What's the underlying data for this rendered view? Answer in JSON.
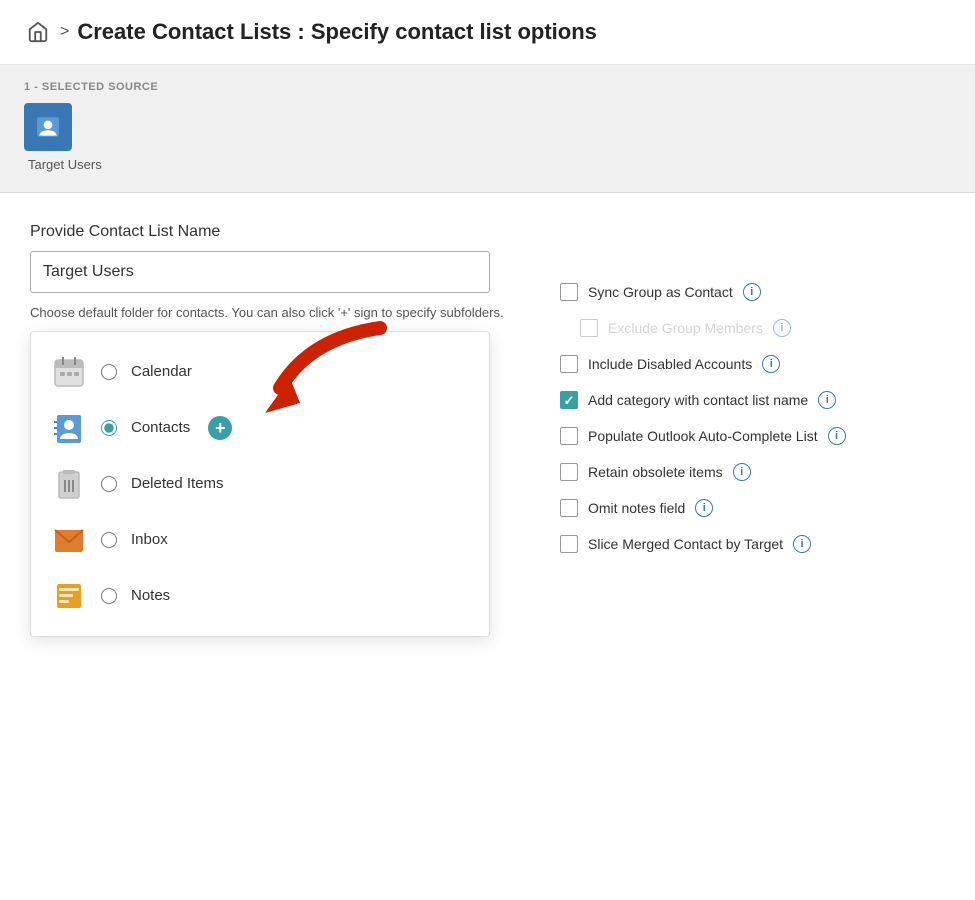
{
  "breadcrumb": {
    "home_icon": "🏠",
    "separator": ">",
    "title": "Create Contact Lists :  Specify contact list options"
  },
  "selected_source": {
    "label": "1 - SELECTED SOURCE",
    "name": "Target Users"
  },
  "form": {
    "field_label": "Provide Contact List Name",
    "input_value": "Target Users",
    "helper_text": "Choose default folder for contacts. You can also click '+' sign to specify subfolders."
  },
  "folders": [
    {
      "id": "calendar",
      "label": "Calendar",
      "selected": false,
      "icon": "calendar"
    },
    {
      "id": "contacts",
      "label": "Contacts",
      "selected": true,
      "icon": "contacts",
      "has_add": true
    },
    {
      "id": "deleted",
      "label": "Deleted Items",
      "selected": false,
      "icon": "deleted"
    },
    {
      "id": "inbox",
      "label": "Inbox",
      "selected": false,
      "icon": "inbox"
    },
    {
      "id": "notes",
      "label": "Notes",
      "selected": false,
      "icon": "notes"
    }
  ],
  "options": [
    {
      "id": "sync-group",
      "label": "Sync Group as Contact",
      "checked": false,
      "disabled": false
    },
    {
      "id": "exclude-group",
      "label": "Exclude Group Members",
      "checked": false,
      "disabled": true
    },
    {
      "id": "include-disabled",
      "label": "Include Disabled Accounts",
      "checked": false,
      "disabled": false
    },
    {
      "id": "add-category",
      "label": "Add category with contact list name",
      "checked": true,
      "disabled": false
    },
    {
      "id": "populate-autocomplete",
      "label": "Populate Outlook Auto-Complete List",
      "checked": false,
      "disabled": false
    },
    {
      "id": "retain-obsolete",
      "label": "Retain obsolete items",
      "checked": false,
      "disabled": false
    },
    {
      "id": "omit-notes",
      "label": "Omit notes field",
      "checked": false,
      "disabled": false
    },
    {
      "id": "slice-merged",
      "label": "Slice Merged Contact by Target",
      "checked": false,
      "disabled": false
    }
  ]
}
